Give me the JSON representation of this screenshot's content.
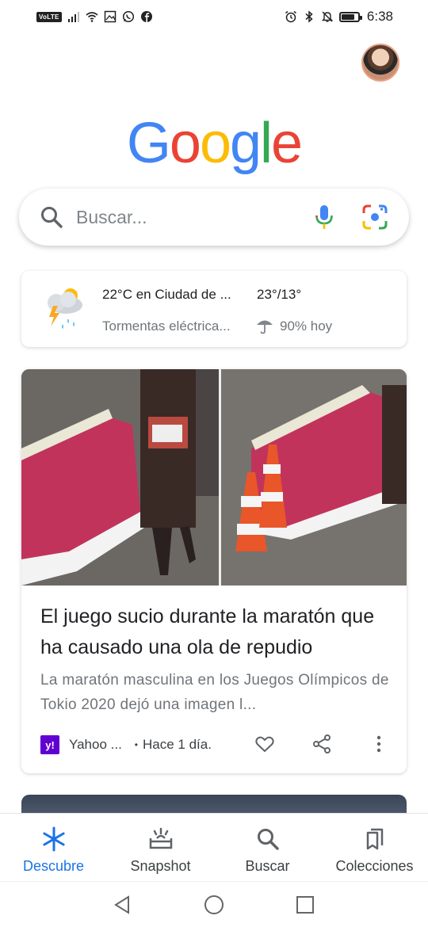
{
  "status_bar": {
    "volte": "VoLTE",
    "time": "6:38",
    "battery_level": 0.8,
    "left_icons": [
      "signal-icon",
      "wifi-icon",
      "gallery-icon",
      "whatsapp-icon",
      "facebook-icon"
    ],
    "right_icons": [
      "alarm-icon",
      "bluetooth-icon",
      "mute-icon",
      "battery-icon"
    ]
  },
  "logo": {
    "letters": [
      "G",
      "o",
      "o",
      "g",
      "l",
      "e"
    ],
    "colors": [
      "#4285F4",
      "#EA4335",
      "#FBBC05",
      "#4285F4",
      "#34A853",
      "#EA4335"
    ]
  },
  "search": {
    "placeholder": "Buscar..."
  },
  "weather": {
    "location": "22°C en Ciudad de ...",
    "temps": "23°/13°",
    "condition": "Tormentas eléctrica...",
    "rain": "90% hoy"
  },
  "article": {
    "title": "El juego sucio durante la maratón que ha causado una ola de repudio",
    "snippet": "La maratón masculina en los Juegos Olímpicos de Tokio 2020 dejó una imagen l...",
    "source_logo": "y!",
    "source": "Yahoo ...",
    "dot": "•",
    "time": "Hace 1 día."
  },
  "bottom_nav": [
    {
      "label": "Descubre",
      "icon": "discover-icon",
      "active": true
    },
    {
      "label": "Snapshot",
      "icon": "snapshot-icon",
      "active": false
    },
    {
      "label": "Buscar",
      "icon": "search-icon",
      "active": false
    },
    {
      "label": "Colecciones",
      "icon": "collections-icon",
      "active": false
    }
  ],
  "colors": {
    "accent": "#1a73e8",
    "text": "#202124",
    "secondary": "#70757a"
  }
}
